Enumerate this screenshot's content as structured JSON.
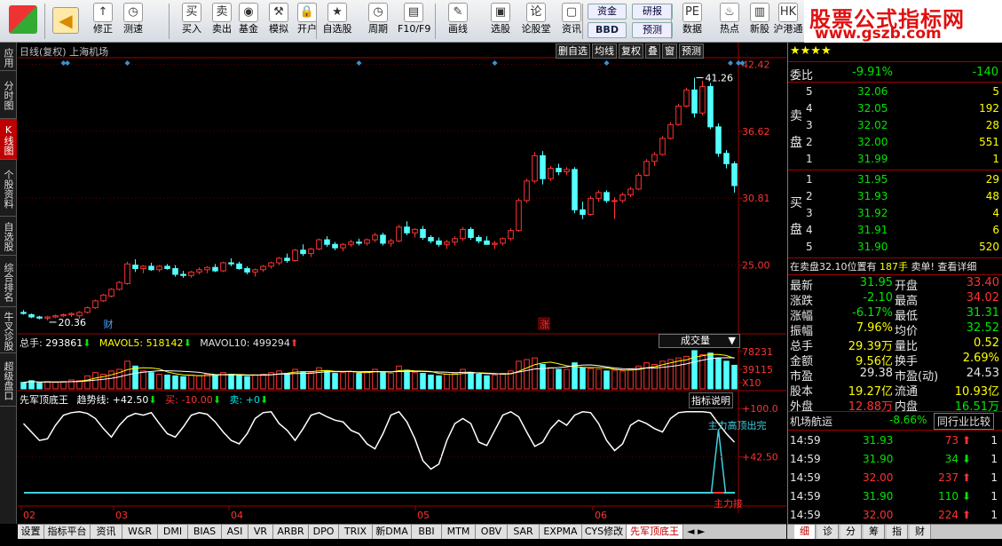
{
  "toolbar": {
    "buttons": [
      {
        "label": "修正",
        "icon": "↑"
      },
      {
        "label": "测速",
        "icon": "◷"
      },
      {
        "label": "买入",
        "icon": "买"
      },
      {
        "label": "卖出",
        "icon": "卖"
      },
      {
        "label": "基金",
        "icon": "◉"
      },
      {
        "label": "模拟",
        "icon": "⚒"
      },
      {
        "label": "开户",
        "icon": "🔒"
      },
      {
        "label": "自选股",
        "icon": "★"
      },
      {
        "label": "周期",
        "icon": "◷"
      },
      {
        "label": "F10/F9",
        "icon": "▤"
      },
      {
        "label": "画线",
        "icon": "✎"
      },
      {
        "label": "选股",
        "icon": "▣"
      },
      {
        "label": "论股堂",
        "icon": "论"
      },
      {
        "label": "资讯",
        "icon": "▢"
      },
      {
        "label": "数据",
        "icon": "PE"
      },
      {
        "label": "热点",
        "icon": "♨"
      },
      {
        "label": "新股",
        "icon": "▥"
      },
      {
        "label": "沪港通",
        "icon": "HK"
      }
    ],
    "small_buttons": {
      "fund": "资金",
      "research": "研报",
      "bbd": "BBD",
      "forecast": "预测"
    }
  },
  "brand": {
    "title": "股票公式指标网",
    "url": "www.gszb.com"
  },
  "left_tabs": [
    "应用",
    "分时图",
    "K线图",
    "个股资料",
    "自选股",
    "综合排名",
    "牛叉诊股",
    "超级盘口"
  ],
  "chart": {
    "title": "日线(复权) 上海机场",
    "buttons": [
      "删自选",
      "均线",
      "复权",
      "叠",
      "窗",
      "预测"
    ],
    "price_axis": [
      "42.42",
      "36.62",
      "30.81",
      "25.00"
    ],
    "max_label": "41.26",
    "min_label": "20.36",
    "markers": {
      "cai": "财",
      "zhang": "涨"
    },
    "volume": {
      "total_label": "总手: ",
      "total_value": "293861",
      "ma5_label": "MAVOL5: ",
      "ma5_value": "518142",
      "ma10_label": "MAVOL10: ",
      "ma10_value": "499294",
      "axis": [
        "78231",
        "39115",
        "X10"
      ],
      "dropdown": "成交量"
    },
    "indicator": {
      "name": "先军顶底王",
      "trend_label": "趋势线: ",
      "trend_value": "+42.50",
      "buy_label": "买: ",
      "buy_value": "-10.00",
      "sell_label": "卖: ",
      "sell_value": "+0",
      "axis": [
        "100.0",
        "42.50"
      ],
      "help": "指标说明",
      "anno_top": "主力高顶出完",
      "anno_bottom": "主力接"
    },
    "x_axis": [
      "02",
      "03",
      "04",
      "05",
      "06"
    ]
  },
  "chart_data": [
    {
      "type": "candlestick",
      "title": "日线(复权) 上海机场",
      "ylim": [
        19.5,
        43
      ],
      "y_ticks": [
        42.42,
        36.62,
        30.81,
        25.0
      ],
      "x_ticks": [
        "02",
        "03",
        "04",
        "05",
        "06"
      ],
      "max": 41.26,
      "min": 20.36,
      "ohlc": [
        [
          20.9,
          21.1,
          20.7,
          20.8
        ],
        [
          20.7,
          20.8,
          20.4,
          20.5
        ],
        [
          20.5,
          20.6,
          20.3,
          20.4
        ],
        [
          20.4,
          20.6,
          20.2,
          20.5
        ],
        [
          20.5,
          20.7,
          20.4,
          20.6
        ],
        [
          20.6,
          20.8,
          20.5,
          20.7
        ],
        [
          20.7,
          20.9,
          20.5,
          20.8
        ],
        [
          20.6,
          21.0,
          20.36,
          20.9
        ],
        [
          20.9,
          21.4,
          20.8,
          21.3
        ],
        [
          21.3,
          22.0,
          21.2,
          21.9
        ],
        [
          21.9,
          22.5,
          21.8,
          22.4
        ],
        [
          22.3,
          23.0,
          22.2,
          22.9
        ],
        [
          22.9,
          23.6,
          22.8,
          23.5
        ],
        [
          23.4,
          25.3,
          23.3,
          25.1
        ],
        [
          25.0,
          25.5,
          24.4,
          24.7
        ],
        [
          24.7,
          25.0,
          24.3,
          24.9
        ],
        [
          24.9,
          25.2,
          24.5,
          24.6
        ],
        [
          24.6,
          25.0,
          24.4,
          24.9
        ],
        [
          24.9,
          25.1,
          24.6,
          24.7
        ],
        [
          24.7,
          25.0,
          24.0,
          24.2
        ],
        [
          24.2,
          24.5,
          23.9,
          24.1
        ],
        [
          24.1,
          24.5,
          23.9,
          24.4
        ],
        [
          24.4,
          24.8,
          24.2,
          24.6
        ],
        [
          24.6,
          24.9,
          24.3,
          24.8
        ],
        [
          24.8,
          25.1,
          24.4,
          24.5
        ],
        [
          24.5,
          25.3,
          24.4,
          25.2
        ],
        [
          25.2,
          25.6,
          24.9,
          25.1
        ],
        [
          25.1,
          25.3,
          24.6,
          24.7
        ],
        [
          24.7,
          24.9,
          24.2,
          24.4
        ],
        [
          24.4,
          24.7,
          24.0,
          24.6
        ],
        [
          24.6,
          25.0,
          24.4,
          24.9
        ],
        [
          24.9,
          25.3,
          24.7,
          25.2
        ],
        [
          25.2,
          25.7,
          25.0,
          25.6
        ],
        [
          25.6,
          26.0,
          25.2,
          25.4
        ],
        [
          25.4,
          26.4,
          25.3,
          26.3
        ],
        [
          26.3,
          26.8,
          25.8,
          26.0
        ],
        [
          26.0,
          26.5,
          25.7,
          26.4
        ],
        [
          26.4,
          27.3,
          26.3,
          27.2
        ],
        [
          27.2,
          27.5,
          26.6,
          26.8
        ],
        [
          26.8,
          27.0,
          26.3,
          26.5
        ],
        [
          26.5,
          26.9,
          26.2,
          26.8
        ],
        [
          26.8,
          27.2,
          26.6,
          27.0
        ],
        [
          27.0,
          27.3,
          26.7,
          26.9
        ],
        [
          26.9,
          27.3,
          26.7,
          27.2
        ],
        [
          27.2,
          27.8,
          27.0,
          27.6
        ],
        [
          27.6,
          27.8,
          26.7,
          26.9
        ],
        [
          26.9,
          27.3,
          26.6,
          27.1
        ],
        [
          27.1,
          28.5,
          27.0,
          28.3
        ],
        [
          28.3,
          28.8,
          27.6,
          27.8
        ],
        [
          27.8,
          28.2,
          27.4,
          28.1
        ],
        [
          28.1,
          28.4,
          27.2,
          27.4
        ],
        [
          27.4,
          27.6,
          26.9,
          27.1
        ],
        [
          27.1,
          27.4,
          26.6,
          26.8
        ],
        [
          26.8,
          27.2,
          26.4,
          27.0
        ],
        [
          27.0,
          27.5,
          26.7,
          27.3
        ],
        [
          27.3,
          28.3,
          27.1,
          28.1
        ],
        [
          28.1,
          28.3,
          27.2,
          27.4
        ],
        [
          27.4,
          27.6,
          26.9,
          27.1
        ],
        [
          27.1,
          27.5,
          26.8,
          26.8
        ],
        [
          26.8,
          27.1,
          26.4,
          26.9
        ],
        [
          26.9,
          27.4,
          26.7,
          27.3
        ],
        [
          27.3,
          28.2,
          27.1,
          28.0
        ],
        [
          28.0,
          30.8,
          27.9,
          30.6
        ],
        [
          30.6,
          32.5,
          30.4,
          32.3
        ],
        [
          32.3,
          34.8,
          32.1,
          34.5
        ],
        [
          34.5,
          34.9,
          32.0,
          32.5
        ],
        [
          32.5,
          33.6,
          32.3,
          33.4
        ],
        [
          33.4,
          33.8,
          32.8,
          33.1
        ],
        [
          33.1,
          33.5,
          32.8,
          33.3
        ],
        [
          33.3,
          33.5,
          29.5,
          29.8
        ],
        [
          29.8,
          30.5,
          29.0,
          29.4
        ],
        [
          29.4,
          31.0,
          29.3,
          30.8
        ],
        [
          30.8,
          31.5,
          30.5,
          31.3
        ],
        [
          31.3,
          31.5,
          30.4,
          30.6
        ],
        [
          30.6,
          30.9,
          29.0,
          30.6
        ],
        [
          30.6,
          31.3,
          30.4,
          31.1
        ],
        [
          31.1,
          31.8,
          30.9,
          31.6
        ],
        [
          31.6,
          33.0,
          31.5,
          32.8
        ],
        [
          32.8,
          34.2,
          32.7,
          34.0
        ],
        [
          34.0,
          34.8,
          33.6,
          34.6
        ],
        [
          34.6,
          36.2,
          34.5,
          36.0
        ],
        [
          36.0,
          37.4,
          35.9,
          37.2
        ],
        [
          37.2,
          39.0,
          37.1,
          38.8
        ],
        [
          38.8,
          40.4,
          38.7,
          40.2
        ],
        [
          40.2,
          41.26,
          37.8,
          38.2
        ],
        [
          38.2,
          41.0,
          38.0,
          40.5
        ],
        [
          40.5,
          40.8,
          36.8,
          37.0
        ],
        [
          37.0,
          37.3,
          34.4,
          34.7
        ],
        [
          34.7,
          35.0,
          33.4,
          33.8
        ],
        [
          33.8,
          34.0,
          31.3,
          31.9
        ]
      ]
    },
    {
      "type": "bar",
      "title": "成交量",
      "series": [
        {
          "name": "总手",
          "values": [
            8,
            10,
            7,
            9,
            8,
            9,
            11,
            10,
            16,
            20,
            18,
            22,
            24,
            34,
            28,
            22,
            20,
            18,
            17,
            16,
            15,
            17,
            16,
            18,
            17,
            20,
            18,
            16,
            15,
            17,
            18,
            20,
            22,
            19,
            24,
            21,
            20,
            26,
            22,
            19,
            20,
            21,
            19,
            21,
            24,
            20,
            19,
            28,
            23,
            20,
            19,
            17,
            16,
            18,
            19,
            24,
            20,
            18,
            16,
            17,
            19,
            22,
            34,
            36,
            38,
            30,
            26,
            24,
            24,
            32,
            26,
            25,
            24,
            22,
            23,
            22,
            24,
            28,
            32,
            30,
            34,
            36,
            38,
            40,
            47,
            42,
            44,
            38,
            34,
            29
          ]
        },
        {
          "name": "MAVOL5",
          "values": [
            518142
          ]
        },
        {
          "name": "MAVOL10",
          "values": [
            499294
          ]
        }
      ],
      "ylim": [
        0,
        78231
      ],
      "y_ticks": [
        78231,
        39115
      ]
    },
    {
      "type": "line",
      "title": "先军顶底王",
      "ylim": [
        0,
        100
      ],
      "y_ticks": [
        100.0,
        42.5
      ],
      "series": [
        {
          "name": "趋势线",
          "values": [
            82,
            72,
            62,
            64,
            80,
            92,
            95,
            96,
            94,
            88,
            76,
            66,
            80,
            90,
            94,
            92,
            95,
            82,
            70,
            66,
            78,
            92,
            95,
            93,
            84,
            72,
            62,
            58,
            70,
            88,
            95,
            96,
            82,
            74,
            62,
            76,
            92,
            95,
            90,
            86,
            84,
            74,
            70,
            58,
            52,
            70,
            92,
            96,
            84,
            64,
            38,
            28,
            34,
            62,
            82,
            88,
            82,
            60,
            56,
            74,
            92,
            96,
            90,
            72,
            55,
            60,
            76,
            86,
            80,
            92,
            96,
            95,
            82,
            62,
            50,
            58,
            80,
            86,
            82,
            76,
            72,
            88,
            95,
            96,
            96,
            96,
            95,
            82,
            70,
            60
          ]
        },
        {
          "name": "买",
          "values": [
            -10.0
          ]
        },
        {
          "name": "卖",
          "values": [
            0
          ]
        }
      ]
    }
  ],
  "orderbook": {
    "wei_label": "委比",
    "wei_pct": "-9.91%",
    "wei_diff": "-140",
    "sell_label": [
      "卖",
      "盘"
    ],
    "buy_label": [
      "买",
      "盘"
    ],
    "sell": [
      {
        "lvl": "5",
        "price": "32.06",
        "vol": "5"
      },
      {
        "lvl": "4",
        "price": "32.05",
        "vol": "192"
      },
      {
        "lvl": "3",
        "price": "32.02",
        "vol": "28"
      },
      {
        "lvl": "2",
        "price": "32.00",
        "vol": "551"
      },
      {
        "lvl": "1",
        "price": "31.99",
        "vol": "1"
      }
    ],
    "buy": [
      {
        "lvl": "1",
        "price": "31.95",
        "vol": "29"
      },
      {
        "lvl": "2",
        "price": "31.93",
        "vol": "48"
      },
      {
        "lvl": "3",
        "price": "31.92",
        "vol": "4"
      },
      {
        "lvl": "4",
        "price": "31.91",
        "vol": "6"
      },
      {
        "lvl": "5",
        "price": "31.90",
        "vol": "520"
      }
    ],
    "info": {
      "text": "在卖盘32.10位置有",
      "vol": "187手",
      "tail": "卖单! 查看详细"
    }
  },
  "quote": [
    {
      "l1": "最新",
      "v1": "31.95",
      "c1": "green",
      "l2": "开盘",
      "v2": "33.40",
      "c2": "red"
    },
    {
      "l1": "涨跌",
      "v1": "-2.10",
      "c1": "green",
      "l2": "最高",
      "v2": "34.02",
      "c2": "red"
    },
    {
      "l1": "涨幅",
      "v1": "-6.17%",
      "c1": "green",
      "l2": "最低",
      "v2": "31.31",
      "c2": "green"
    },
    {
      "l1": "振幅",
      "v1": "7.96%",
      "c1": "yellow",
      "l2": "均价",
      "v2": "32.52",
      "c2": "green"
    },
    {
      "l1": "总手",
      "v1": "29.39万",
      "c1": "yellow",
      "l2": "量比",
      "v2": "0.52",
      "c2": "yellow"
    },
    {
      "l1": "金额",
      "v1": "9.56亿",
      "c1": "yellow",
      "l2": "换手",
      "v2": "2.69%",
      "c2": "yellow"
    },
    {
      "l1": "市盈",
      "v1": "29.38",
      "c1": "white",
      "l2": "市盈(动)",
      "v2": "24.53",
      "c2": "white"
    },
    {
      "l1": "股本",
      "v1": "19.27亿",
      "c1": "yellow",
      "l2": "流通",
      "v2": "10.93亿",
      "c2": "yellow"
    },
    {
      "l1": "外盘",
      "v1": "12.88万",
      "c1": "red",
      "l2": "内盘",
      "v2": "16.51万",
      "c2": "green"
    }
  ],
  "sector": {
    "name": "机场航运",
    "pct": "-8.66%",
    "compare": "同行业比较"
  },
  "ticks": [
    {
      "time": "14:59",
      "price": "31.93",
      "vol": "73",
      "dir": "up",
      "n": "1"
    },
    {
      "time": "14:59",
      "price": "31.90",
      "vol": "34",
      "dir": "down",
      "n": "1"
    },
    {
      "time": "14:59",
      "price": "32.00",
      "vol": "237",
      "dir": "up",
      "n": "1"
    },
    {
      "time": "14:59",
      "price": "31.90",
      "vol": "110",
      "dir": "down",
      "n": "1"
    },
    {
      "time": "14:59",
      "price": "32.00",
      "vol": "224",
      "dir": "up",
      "n": "1"
    }
  ],
  "bottom_tabs": [
    "设置",
    "指标平台",
    "资讯",
    "W&R",
    "DMI",
    "BIAS",
    "ASI",
    "VR",
    "ARBR",
    "DPO",
    "TRIX",
    "新DMA",
    "BBI",
    "MTM",
    "OBV",
    "SAR",
    "EXPMA",
    "CYS修改",
    "先军顶底王"
  ],
  "right_tabs": [
    "细",
    "诊",
    "分",
    "筹",
    "指",
    "财"
  ],
  "colors": {
    "up": "#ff3232",
    "down": "#54ffff",
    "axis": "#a00000",
    "volume_ma": "#ffffff"
  }
}
